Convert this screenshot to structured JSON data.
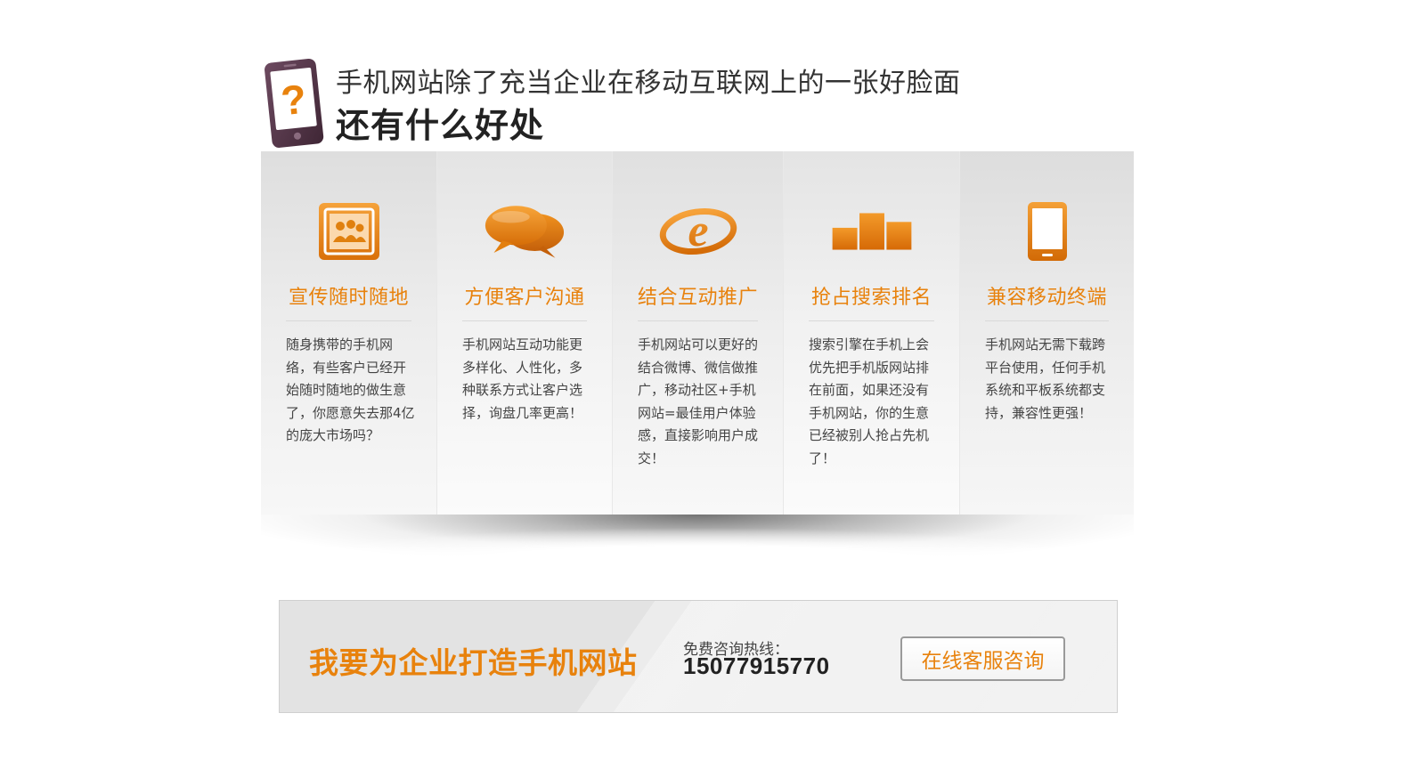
{
  "header": {
    "logo_icon": "phone-question-icon",
    "title_line1": "手机网站除了充当企业在移动互联网上的一张好脸面",
    "title_line2": "还有什么好处"
  },
  "colors": {
    "accent": "#e8820d",
    "logo_frame": "#5a3b4f"
  },
  "features": [
    {
      "icon": "photo-group-icon",
      "title": "宣传随时随地",
      "description": "随身携带的手机网络，有些客户已经开始随时随地的做生意了，你愿意失去那4亿的庞大市场吗？"
    },
    {
      "icon": "chat-bubbles-icon",
      "title": "方便客户沟通",
      "description": "手机网站互动功能更多样化、人性化，多种联系方式让客户选择，询盘几率更高！"
    },
    {
      "icon": "letter-e-icon",
      "title": "结合互动推广",
      "description": "手机网站可以更好的结合微博、微信做推广，移动社区+手机网站=最佳用户体验感，直接影响用户成交！"
    },
    {
      "icon": "ranking-bars-icon",
      "title": "抢占搜索排名",
      "description": "搜索引擎在手机上会优先把手机版网站排在前面，如果还没有手机网站，你的生意已经被别人抢占先机了！"
    },
    {
      "icon": "mobile-device-icon",
      "title": "兼容移动终端",
      "description": "手机网站无需下载跨平台使用，任何手机系统和平板系统都支持，兼容性更强！"
    }
  ],
  "cta": {
    "title": "我要为企业打造手机网站",
    "hotline_label": "免费咨询热线：",
    "hotline_number": "15077915770",
    "button_label": "在线客服咨询"
  }
}
